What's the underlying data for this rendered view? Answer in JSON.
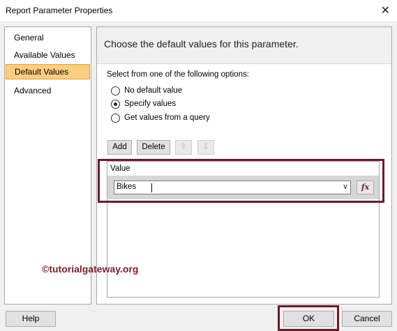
{
  "window": {
    "title": "Report Parameter Properties"
  },
  "nav": {
    "items": [
      "General",
      "Available Values",
      "Default Values",
      "Advanced"
    ],
    "selected_index": 2
  },
  "header": {
    "text": "Choose the default values for this parameter."
  },
  "options": {
    "label": "Select from one of the following options:",
    "choices": [
      "No default value",
      "Specify values",
      "Get values from a query"
    ],
    "selected_index": 1
  },
  "toolbar": {
    "add_label": "Add",
    "delete_label": "Delete"
  },
  "grid": {
    "column_header": "Value",
    "rows": [
      {
        "value": "Bikes"
      }
    ]
  },
  "watermark": "©tutorialgateway.org",
  "footer": {
    "help_label": "Help",
    "ok_label": "OK",
    "cancel_label": "Cancel"
  },
  "colors": {
    "nav_selected": "#fdce80",
    "highlight_border": "#6b1a2b",
    "watermark": "#7a1f28"
  }
}
